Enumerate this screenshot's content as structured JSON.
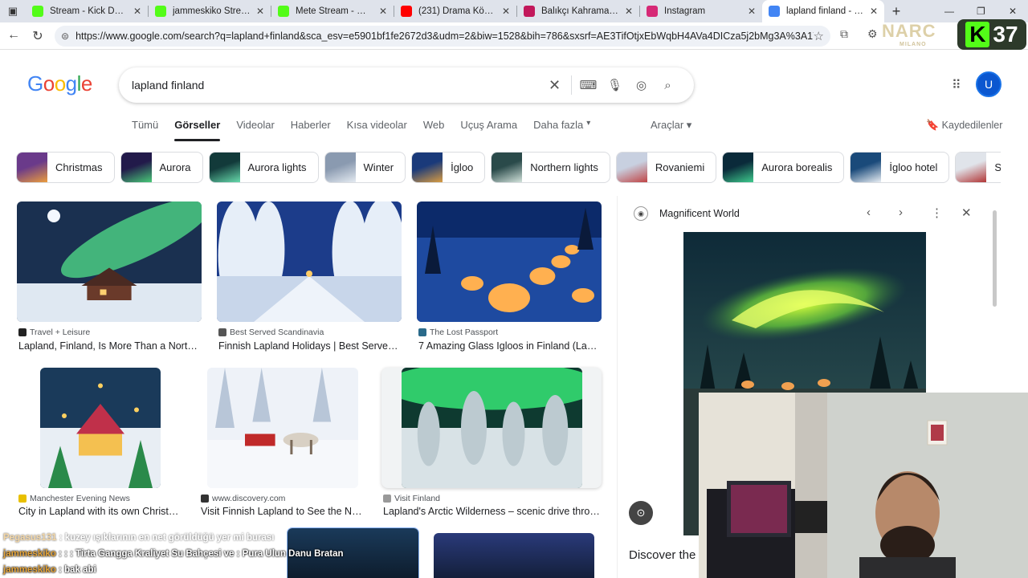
{
  "tabs": [
    {
      "title": "Stream - Kick Dashboard",
      "favicon": "kick-icon",
      "color": "#53fc18"
    },
    {
      "title": "jammeskiko Stream - Watch",
      "favicon": "kick-icon",
      "color": "#53fc18"
    },
    {
      "title": "Mete Stream - Watch Live",
      "favicon": "kick-icon",
      "color": "#53fc18"
    },
    {
      "title": "(231) Drama Köprüsü",
      "favicon": "youtube-icon",
      "color": "#ff0000"
    },
    {
      "title": "Balıkçı Kahraman – İsta",
      "favicon": "site-icon",
      "color": "#c2185b"
    },
    {
      "title": "Instagram",
      "favicon": "instagram-icon",
      "color": "#d62976"
    },
    {
      "title": "lapland finland - Google",
      "favicon": "google-icon",
      "color": "#4285f4",
      "active": true
    }
  ],
  "address": {
    "url": "https://www.google.com/search?q=lapland+finland&sca_esv=e5901bf1fe2672d3&udm=2&biw=1528&bih=786&sxsrf=AE3TifOtjxEbWqbH4AVa4DICza5j2bMg3A%3A1763920..."
  },
  "overlay": {
    "logo_text": "NARC",
    "logo_sub": "MILANO",
    "badge_number": "37",
    "badge_letter": "K"
  },
  "google": {
    "logo": "Google",
    "query": "lapland finland",
    "avatar_letter": "U",
    "nav_tabs": [
      "Tümü",
      "Görseller",
      "Videolar",
      "Haberler",
      "Kısa videolar",
      "Web",
      "Uçuş Arama",
      "Daha fazla"
    ],
    "active_tab": "Görseller",
    "tools": "Araçlar",
    "saved": "Kaydedilenler"
  },
  "chips": [
    "Christmas",
    "Aurora",
    "Aurora lights",
    "Winter",
    "İgloo",
    "Northern lights",
    "Rovaniemi",
    "Aurora borealis",
    "İgloo hotel",
    "Ski"
  ],
  "results": [
    {
      "source": "Travel + Leisure",
      "caption": "Lapland, Finland, Is More Than a Northern ...",
      "scene": "aurora-cabin"
    },
    {
      "source": "Best Served Scandinavia",
      "caption": "Finnish Lapland Holidays | Best Served ...",
      "scene": "snow-forest"
    },
    {
      "source": "The Lost Passport",
      "caption": "7 Amazing Glass Igloos in Finland (Lapland ...",
      "scene": "igloos"
    },
    {
      "source": "Manchester Evening News",
      "caption": "City in Lapland with its own Christmas ...",
      "scene": "christmas-village"
    },
    {
      "source": "www.discovery.com",
      "caption": "Visit Finnish Lapland to See the Northern ...",
      "scene": "reindeer-sleigh"
    },
    {
      "source": "Visit Finland",
      "caption": "Lapland's Arctic Wilderness – scenic drive through ...",
      "scene": "aurora-trees"
    }
  ],
  "panel": {
    "source": "Magnificent World",
    "discover": "Discover the"
  },
  "chat": [
    {
      "user": "Pegasus131",
      "message": "kuzey ışıklarının en net görüldüğü yer mi burası"
    },
    {
      "user": "jammeskiko",
      "message": ": : Tirta Gangga Kraliyet Su Bahçesi ve : Pura Ulun Danu Bratan"
    },
    {
      "user": "jammeskiko",
      "message": "bak abi"
    }
  ]
}
